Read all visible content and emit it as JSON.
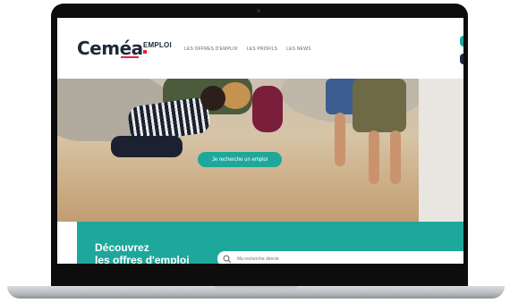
{
  "header": {
    "logo_text": "Ceméa",
    "logo_suffix": "EMPLOI",
    "nav": [
      {
        "label": "LES OFFRES D'EMPLOI"
      },
      {
        "label": "LES PROFILS"
      },
      {
        "label": "LES NEWS"
      }
    ]
  },
  "hero": {
    "cta_label": "Je recherche un emploi"
  },
  "band": {
    "title_line1": "Découvrez",
    "title_line2": "les offres d'emploi",
    "search_placeholder": "Ma recherche directe"
  },
  "colors": {
    "accent": "#1ea79b",
    "logo_red": "#e3233a",
    "text_dark": "#1f2a3a"
  },
  "icons": [
    "search-icon"
  ]
}
